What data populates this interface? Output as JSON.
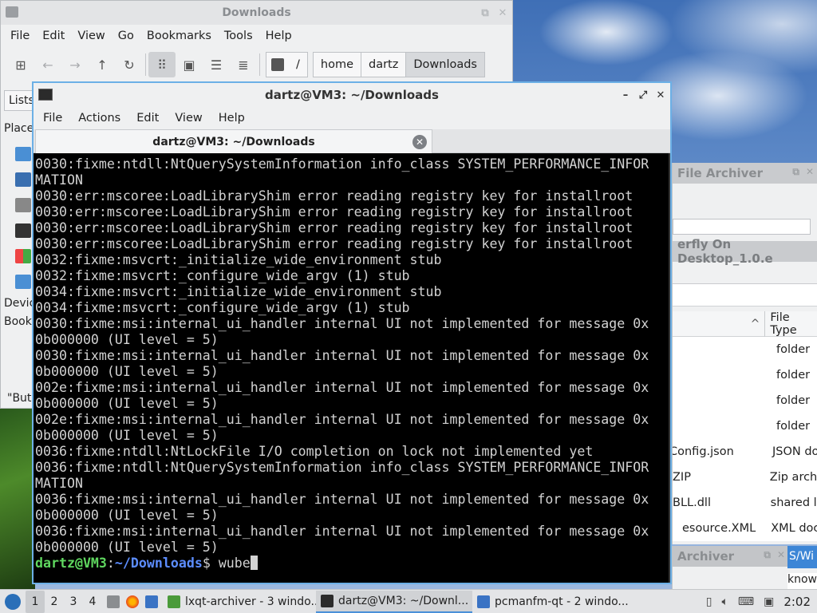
{
  "file_manager": {
    "title": "Downloads",
    "menu": [
      "File",
      "Edit",
      "View",
      "Go",
      "Bookmarks",
      "Tools",
      "Help"
    ],
    "breadcrumbs": [
      "/",
      "home",
      "dartz",
      "Downloads"
    ],
    "side_tab": "Lists",
    "side_rows": [
      "Place",
      "Devic",
      "Book"
    ],
    "status_text": "\"But"
  },
  "archiver_1": {
    "title": "File Archiver",
    "subtitle": "erfly On Desktop_1.0.e",
    "column_header": "File Type",
    "rows": [
      {
        "name": "",
        "type": "folder"
      },
      {
        "name": "",
        "type": "folder"
      },
      {
        "name": "",
        "type": "folder"
      },
      {
        "name": "",
        "type": "folder"
      },
      {
        "name": "Config.json",
        "type": "JSON do"
      },
      {
        "name": "ZIP",
        "type": "Zip archi"
      },
      {
        "name": "BLL.dll",
        "type": "shared li"
      },
      {
        "name": "esource.XML",
        "type": "XML doc"
      }
    ]
  },
  "archiver_2": {
    "title": "Archiver",
    "extra1": "S/Wi",
    "extra2": "known"
  },
  "terminal": {
    "title": "dartz@VM3: ~/Downloads",
    "menu": [
      "File",
      "Actions",
      "Edit",
      "View",
      "Help"
    ],
    "tab_label": "dartz@VM3: ~/Downloads",
    "lines": [
      "0030:fixme:ntdll:NtQuerySystemInformation info_class SYSTEM_PERFORMANCE_INFOR",
      "MATION",
      "0030:err:mscoree:LoadLibraryShim error reading registry key for installroot",
      "0030:err:mscoree:LoadLibraryShim error reading registry key for installroot",
      "0030:err:mscoree:LoadLibraryShim error reading registry key for installroot",
      "0030:err:mscoree:LoadLibraryShim error reading registry key for installroot",
      "0032:fixme:msvcrt:_initialize_wide_environment stub",
      "0032:fixme:msvcrt:_configure_wide_argv (1) stub",
      "0034:fixme:msvcrt:_initialize_wide_environment stub",
      "0034:fixme:msvcrt:_configure_wide_argv (1) stub",
      "0030:fixme:msi:internal_ui_handler internal UI not implemented for message 0x",
      "0b000000 (UI level = 5)",
      "0030:fixme:msi:internal_ui_handler internal UI not implemented for message 0x",
      "0b000000 (UI level = 5)",
      "002e:fixme:msi:internal_ui_handler internal UI not implemented for message 0x",
      "0b000000 (UI level = 5)",
      "002e:fixme:msi:internal_ui_handler internal UI not implemented for message 0x",
      "0b000000 (UI level = 5)",
      "0036:fixme:ntdll:NtLockFile I/O completion on lock not implemented yet",
      "0036:fixme:ntdll:NtQuerySystemInformation info_class SYSTEM_PERFORMANCE_INFOR",
      "MATION",
      "0036:fixme:msi:internal_ui_handler internal UI not implemented for message 0x",
      "0b000000 (UI level = 5)",
      "0036:fixme:msi:internal_ui_handler internal UI not implemented for message 0x",
      "0b000000 (UI level = 5)"
    ],
    "prompt_user": "dartz@VM3",
    "prompt_sep": ":",
    "prompt_path": "~/Downloads",
    "prompt_symbol": "$ ",
    "command_input": "wube"
  },
  "taskbar": {
    "desktops": [
      "1",
      "2",
      "3",
      "4"
    ],
    "tasks": [
      "lxqt-archiver - 3 windo...",
      "dartz@VM3: ~/Downl...",
      "pcmanfm-qt - 2 windo..."
    ],
    "clock": "2:02"
  },
  "colors": {
    "terminal_bg": "#000000",
    "terminal_fg": "#d2d2d2",
    "prompt_user": "#5fd75f",
    "prompt_path": "#5c8dff",
    "active_border": "#6cb0e6"
  }
}
